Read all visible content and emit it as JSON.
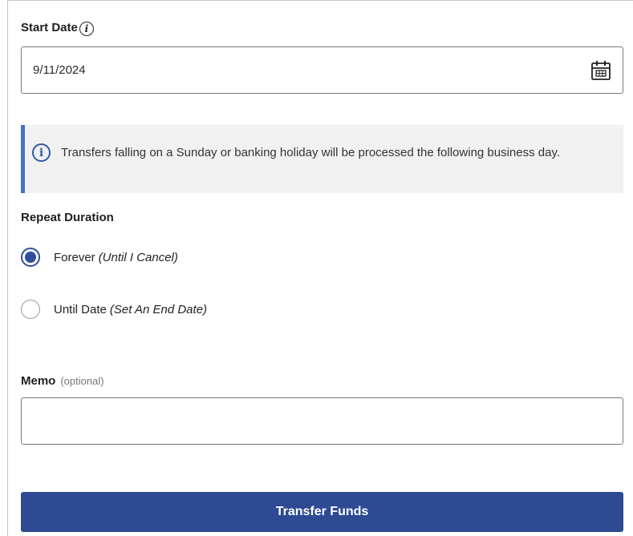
{
  "start_date": {
    "label": "Start Date",
    "info_glyph": "i",
    "value": "9/11/2024",
    "icon": "calendar-icon"
  },
  "notice": {
    "icon": "info-circle-icon",
    "icon_glyph": "i",
    "text": "Transfers falling on a Sunday or banking holiday will be processed the following business day.",
    "accent": "#4572c4"
  },
  "repeat": {
    "label": "Repeat Duration",
    "options": [
      {
        "label": "Forever",
        "hint": "(Until I Cancel)",
        "selected": true
      },
      {
        "label": "Until Date",
        "hint": "(Set An End Date)",
        "selected": false
      }
    ]
  },
  "memo": {
    "label": "Memo",
    "optional": "(optional)",
    "value": ""
  },
  "submit": {
    "label": "Transfer Funds",
    "color": "#2d4a93"
  }
}
